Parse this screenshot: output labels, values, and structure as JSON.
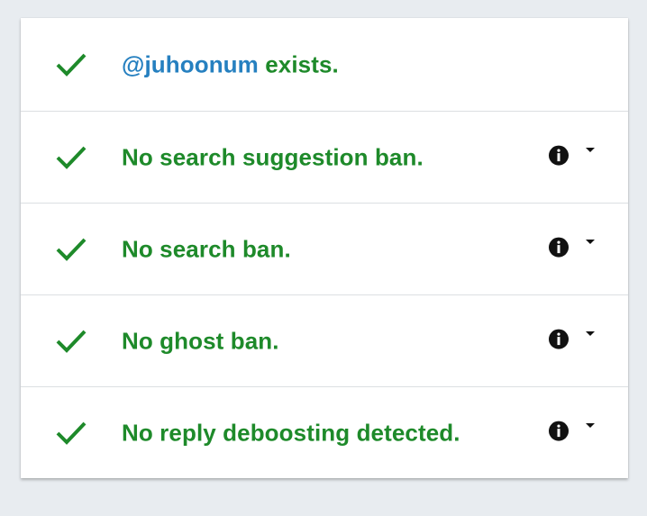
{
  "colors": {
    "success": "#1e8a2a",
    "handle": "#2680c0",
    "icon": "#111111"
  },
  "rows": [
    {
      "icon": "checkmark-icon",
      "handle": "@juhoonum",
      "text": " exists."
    },
    {
      "icon": "checkmark-icon",
      "text": "No search suggestion ban.",
      "actions": [
        "info-icon",
        "chevron-down-icon"
      ]
    },
    {
      "icon": "checkmark-icon",
      "text": "No search ban.",
      "actions": [
        "info-icon",
        "chevron-down-icon"
      ]
    },
    {
      "icon": "checkmark-icon",
      "text": "No ghost ban.",
      "actions": [
        "info-icon",
        "chevron-down-icon"
      ]
    },
    {
      "icon": "checkmark-icon",
      "text": "No reply deboosting detected.",
      "actions": [
        "info-icon",
        "chevron-down-icon"
      ]
    }
  ]
}
